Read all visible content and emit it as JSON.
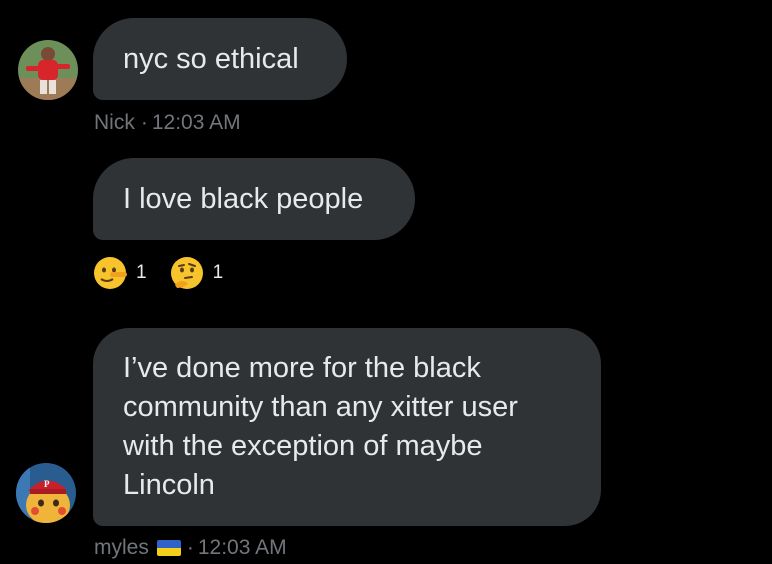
{
  "colors": {
    "background": "#000000",
    "bubble": "#2f3336",
    "text": "#e7e9ea",
    "meta_text": "#71767b",
    "flag_blue": "#2f63c9",
    "flag_yellow": "#f3d11b"
  },
  "messages": [
    {
      "text": "nyc so ethical",
      "avatar_icon": "baseball-player-avatar-icon"
    },
    {
      "text": "I love black people",
      "sender": "Nick",
      "time": "12:03 AM",
      "reactions": [
        {
          "emoji": "lying-face-icon",
          "count": "1"
        },
        {
          "emoji": "thinking-face-icon",
          "count": "1"
        }
      ]
    },
    {
      "text": "I’ve done more for the black community than any xitter user with the exception of maybe Lincoln",
      "sender": "myles",
      "sender_flag": "ukraine-flag-icon",
      "time": "12:03 AM",
      "avatar_icon": "pikachu-phillies-avatar-icon"
    }
  ],
  "meta_separator": "·"
}
